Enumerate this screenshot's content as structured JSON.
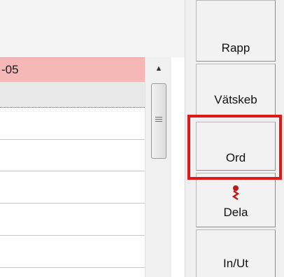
{
  "list": {
    "selected_row_text": "-05"
  },
  "buttons": {
    "rapp": "Rapp",
    "vatskeb": "Vätskeb",
    "ord": "Ord",
    "dela": "Dela",
    "inut": "In/Ut"
  },
  "scrollbar": {
    "up_arrow": "▲"
  },
  "icons": {
    "dela_icon": "red-pin-icon"
  },
  "colors": {
    "selected_row": "#f6b7b7",
    "highlight_border": "#e01818"
  }
}
